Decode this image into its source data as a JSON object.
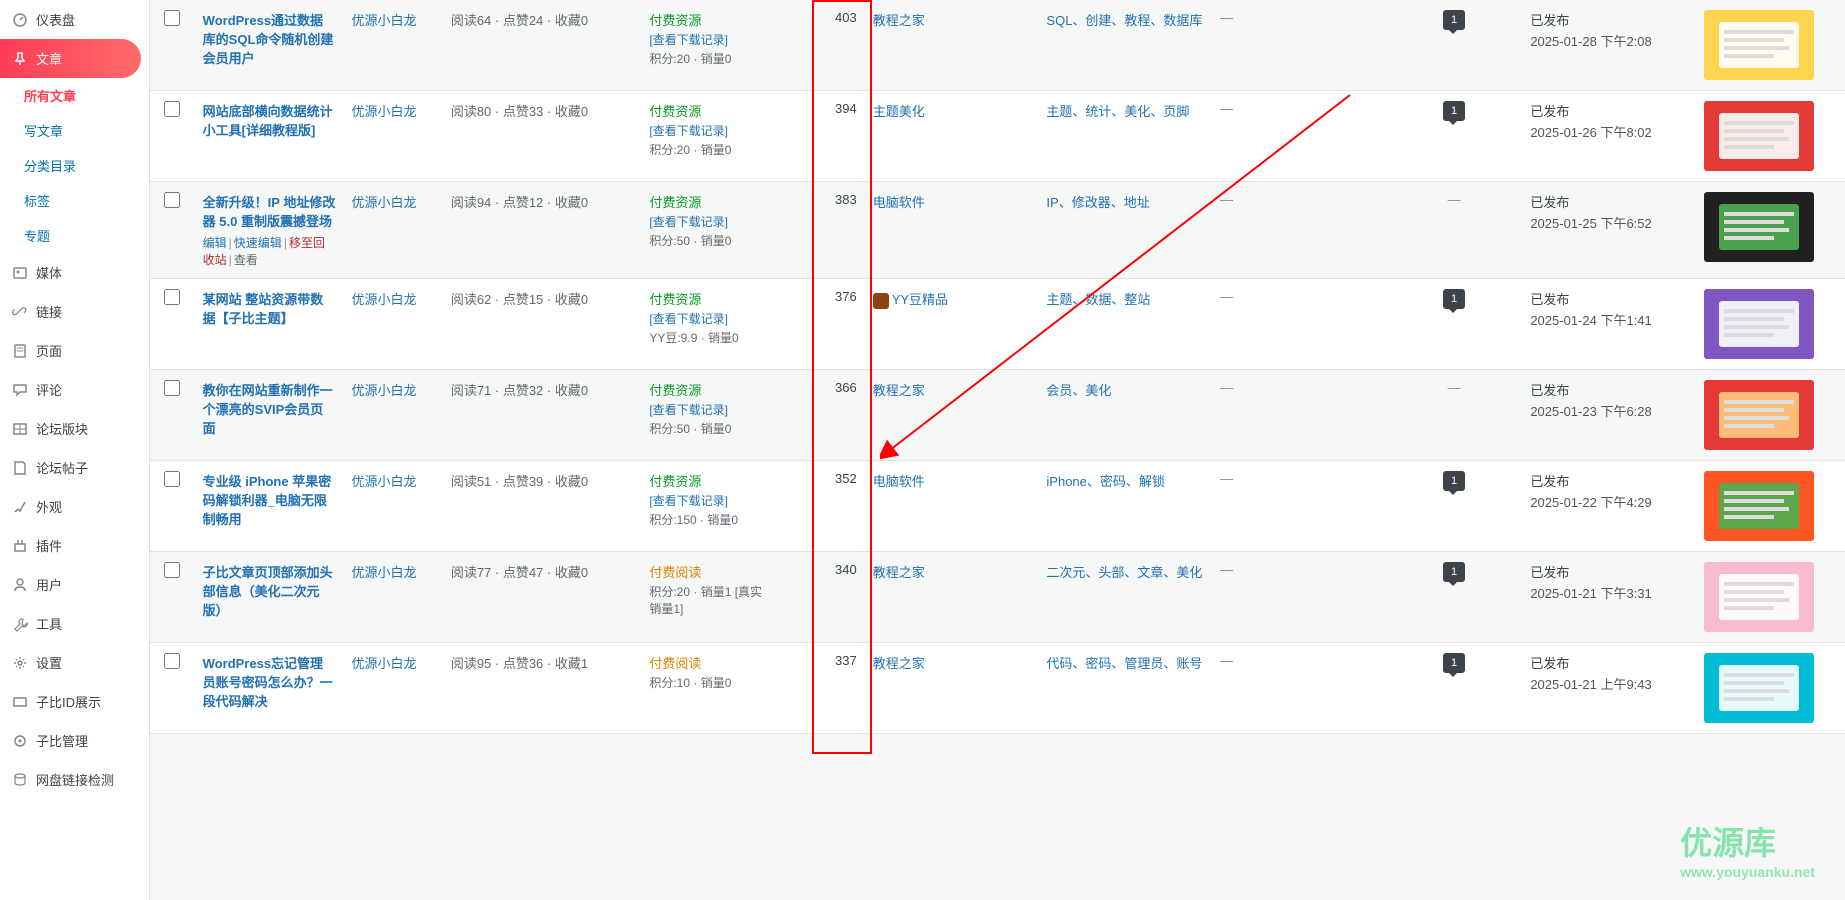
{
  "sidebar": {
    "main": [
      {
        "icon": "dashboard",
        "label": "仪表盘"
      },
      {
        "icon": "pin",
        "label": "文章",
        "active": true
      },
      {
        "icon": "media",
        "label": "媒体"
      },
      {
        "icon": "link",
        "label": "链接"
      },
      {
        "icon": "page",
        "label": "页面"
      },
      {
        "icon": "comment",
        "label": "评论"
      },
      {
        "icon": "forum",
        "label": "论坛版块"
      },
      {
        "icon": "post",
        "label": "论坛帖子"
      },
      {
        "icon": "appearance",
        "label": "外观"
      },
      {
        "icon": "plugin",
        "label": "插件"
      },
      {
        "icon": "user",
        "label": "用户"
      },
      {
        "icon": "tool",
        "label": "工具"
      },
      {
        "icon": "settings",
        "label": "设置"
      },
      {
        "icon": "zibll",
        "label": "子比ID展示"
      },
      {
        "icon": "zibll2",
        "label": "子比管理"
      },
      {
        "icon": "netdisk",
        "label": "网盘链接检测"
      }
    ],
    "sub": [
      {
        "label": "所有文章",
        "sel": true
      },
      {
        "label": "写文章"
      },
      {
        "label": "分类目录"
      },
      {
        "label": "标签"
      },
      {
        "label": "专题"
      }
    ]
  },
  "rows": [
    {
      "title": "WordPress通过数据库的SQL命令随机创建会员用户",
      "author": "优源小白龙",
      "stats": "阅读64 · 点赞24 · 收藏0",
      "resType": "paid",
      "resLabel": "付费资源",
      "resLink": "[查看下载记录]",
      "resMeta": "积分:20 · 销量0",
      "views": "403",
      "cat": "教程之家",
      "tags": "SQL、创建、教程、数据库",
      "hasMsg": true,
      "msg": "1",
      "status": "已发布",
      "date": "2025-01-28 下午2:08",
      "thumbType": "doc"
    },
    {
      "title": "网站底部横向数据统计小工具[详细教程版]",
      "author": "优源小白龙",
      "stats": "阅读80 · 点赞33 · 收藏0",
      "resType": "paid",
      "resLabel": "付费资源",
      "resLink": "[查看下载记录]",
      "resMeta": "积分:20 · 销量0",
      "views": "394",
      "cat": "主题美化",
      "tags": "主题、统计、美化、页脚",
      "hasMsg": true,
      "msg": "1",
      "status": "已发布",
      "date": "2025-01-26 下午8:02",
      "thumbType": "red"
    },
    {
      "title": "全新升级！IP 地址修改器 5.0 重制版震撼登场",
      "author": "优源小白龙",
      "stats": "阅读94 · 点赞12 · 收藏0",
      "resType": "paid",
      "resLabel": "付费资源",
      "resLink": "[查看下载记录]",
      "resMeta": "积分:50 · 销量0",
      "views": "383",
      "cat": "电脑软件",
      "tags": "IP、修改器、地址",
      "hasMsg": false,
      "msg": "",
      "status": "已发布",
      "date": "2025-01-25 下午6:52",
      "thumbType": "dark",
      "showActions": true,
      "actions": {
        "edit": "编辑",
        "quick": "快速编辑",
        "trash": "移至回收站",
        "view": "查看"
      }
    },
    {
      "title": "某网站 整站资源带数据【子比主题】",
      "author": "优源小白龙",
      "stats": "阅读62 · 点赞15 · 收藏0",
      "resType": "paid",
      "resLabel": "付费资源",
      "resLink": "[查看下载记录]",
      "resMeta": "YY豆:9.9 · 销量0",
      "views": "376",
      "cat": "YY豆精品",
      "catIcon": true,
      "tags": "主题、数据、整站",
      "hasMsg": true,
      "msg": "1",
      "status": "已发布",
      "date": "2025-01-24 下午1:41",
      "thumbType": "purple"
    },
    {
      "title": "教你在网站重新制作一个漂亮的SVIP会员页面",
      "author": "优源小白龙",
      "stats": "阅读71 · 点赞32 · 收藏0",
      "resType": "paid",
      "resLabel": "付费资源",
      "resLink": "[查看下载记录]",
      "resMeta": "积分:50 · 销量0",
      "views": "366",
      "cat": "教程之家",
      "tags": "会员、美化",
      "hasMsg": false,
      "msg": "",
      "status": "已发布",
      "date": "2025-01-23 下午6:28",
      "thumbType": "redcard"
    },
    {
      "title": "专业级 iPhone 苹果密码解锁利器_电脑无限制畅用",
      "author": "优源小白龙",
      "stats": "阅读51 · 点赞39 · 收藏0",
      "resType": "paid",
      "resLabel": "付费资源",
      "resLink": "[查看下载记录]",
      "resMeta": "积分:150 · 销量0",
      "views": "352",
      "cat": "电脑软件",
      "tags": "iPhone、密码、解锁",
      "hasMsg": true,
      "msg": "1",
      "status": "已发布",
      "date": "2025-01-22 下午4:29",
      "thumbType": "orange"
    },
    {
      "title": "子比文章页顶部添加头部信息（美化二次元版）",
      "author": "优源小白龙",
      "stats": "阅读77 · 点赞47 · 收藏0",
      "resType": "read",
      "resLabel": "付费阅读",
      "resLink": "",
      "resMeta": "积分:20 · 销量1 [真实销量1]",
      "views": "340",
      "cat": "教程之家",
      "tags": "二次元、头部、文章、美化",
      "hasMsg": true,
      "msg": "1",
      "status": "已发布",
      "date": "2025-01-21 下午3:31",
      "thumbType": "pink"
    },
    {
      "title": "WordPress忘记管理员账号密码怎么办？一段代码解决",
      "author": "优源小白龙",
      "stats": "阅读95 · 点赞36 · 收藏1",
      "resType": "read",
      "resLabel": "付费阅读",
      "resLink": "",
      "resMeta": "积分:10 · 销量0",
      "views": "337",
      "cat": "教程之家",
      "tags": "代码、密码、管理员、账号",
      "hasMsg": true,
      "msg": "1",
      "status": "已发布",
      "date": "2025-01-21 上午9:43",
      "thumbType": "cyan"
    }
  ],
  "dashChar": "—",
  "watermark": {
    "title": "优源库",
    "url": "www.youyuanku.net"
  }
}
